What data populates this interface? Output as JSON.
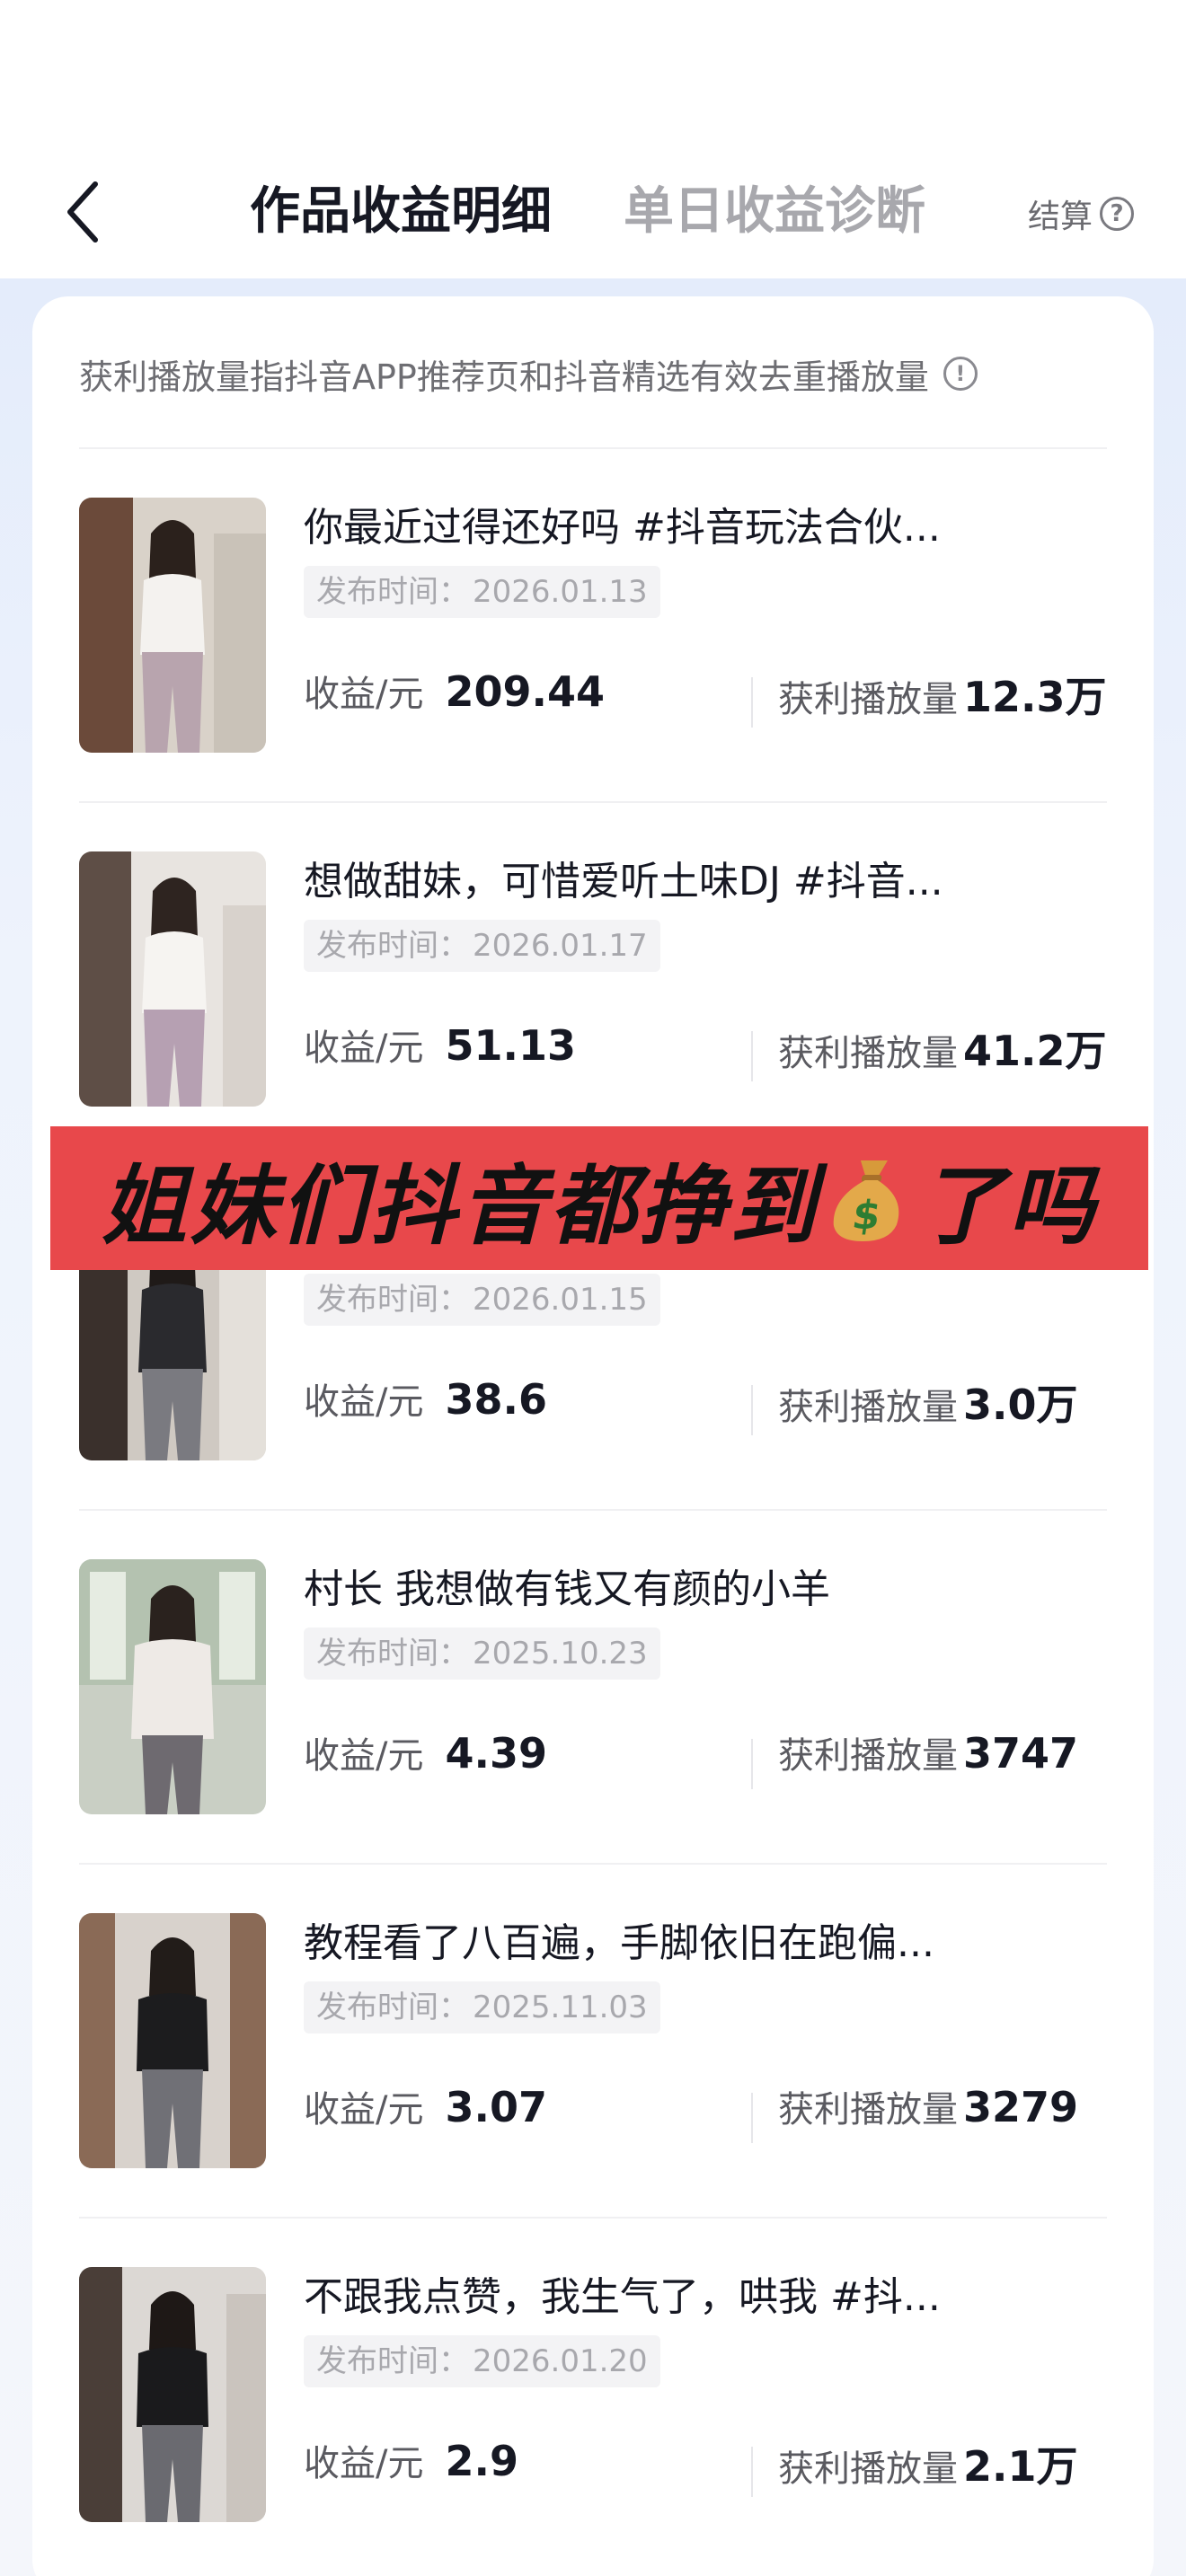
{
  "header": {
    "tab_active": "作品收益明细",
    "tab_inactive": "单日收益诊断",
    "settle_label": "结算",
    "back_icon": "chevron-left-icon",
    "help_icon": "question-circle-icon"
  },
  "notice": {
    "text": "获利播放量指抖音APP推荐页和抖音精选有效去重播放量",
    "icon": "info-circle-icon"
  },
  "list_labels": {
    "date_label": "发布时间：",
    "revenue_label": "收益/元",
    "plays_label": "获利播放量"
  },
  "items": [
    {
      "title": "你最近过得还好吗 #抖音玩法合伙...",
      "date": "2026.01.13",
      "revenue": "209.44",
      "plays": "12.3万"
    },
    {
      "title": "想做甜妹，可惜爱听土味DJ #抖音...",
      "date": "2026.01.17",
      "revenue": "51.13",
      "plays": "41.2万"
    },
    {
      "title": "",
      "date": "2026.01.15",
      "revenue": "38.6",
      "plays": "3.0万"
    },
    {
      "title": "村长 我想做有钱又有颜的小羊",
      "date": "2025.10.23",
      "revenue": "4.39",
      "plays": "3747"
    },
    {
      "title": "教程看了八百遍，手脚依旧在跑偏...",
      "date": "2025.11.03",
      "revenue": "3.07",
      "plays": "3279"
    },
    {
      "title": "不跟我点赞，我生气了，哄我 #抖...",
      "date": "2026.01.20",
      "revenue": "2.9",
      "plays": "2.1万"
    }
  ],
  "banner": {
    "text_before": "姐妹们抖音都挣到",
    "text_after": "了吗",
    "icon": "money-bag-icon"
  },
  "colors": {
    "banner_bg": "#e8484b",
    "accent_text": "#161823",
    "muted_text": "#a8a8ad"
  }
}
